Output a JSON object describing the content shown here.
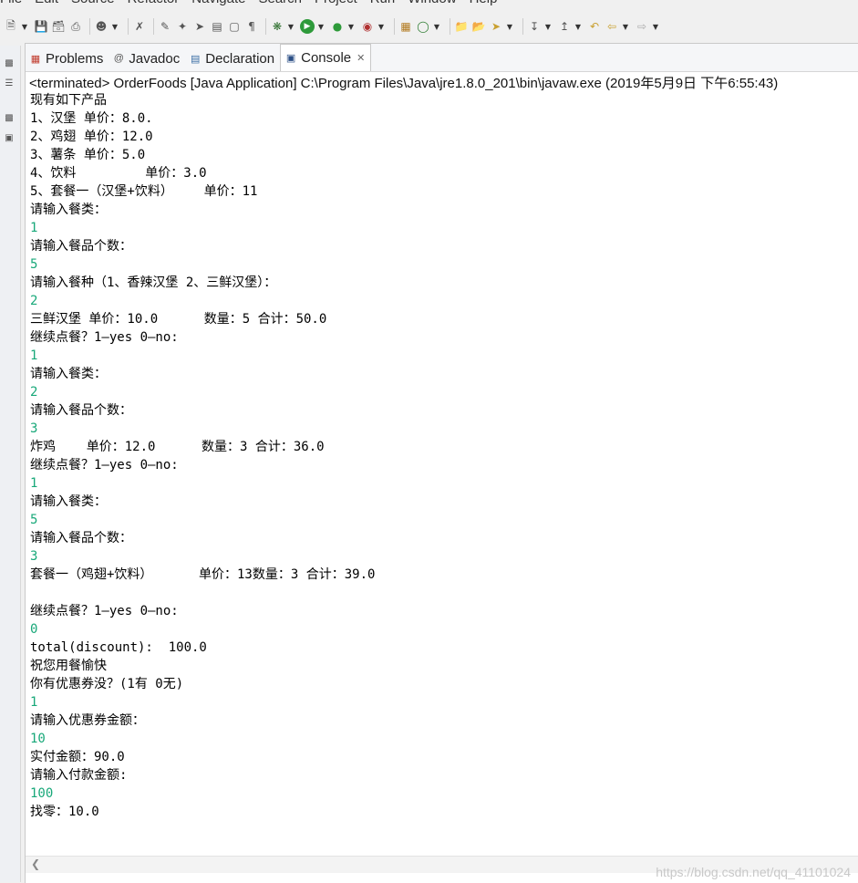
{
  "menubar": {
    "items": [
      "File",
      "Edit",
      "Source",
      "Refactor",
      "Navigate",
      "Search",
      "Project",
      "Run",
      "Window",
      "Help"
    ]
  },
  "tabs": [
    {
      "label": "Problems",
      "icon": "problems-icon"
    },
    {
      "label": "Javadoc",
      "icon": "at-icon"
    },
    {
      "label": "Declaration",
      "icon": "declaration-icon"
    },
    {
      "label": "Console",
      "icon": "console-icon"
    }
  ],
  "console": {
    "title": "<terminated> OrderFoods [Java Application] C:\\Program Files\\Java\\jre1.8.0_201\\bin\\javaw.exe (2019年5月9日 下午6:55:43)",
    "lines": [
      {
        "text": "现有如下产品",
        "type": "out"
      },
      {
        "text": "1、汉堡 单价：8.0.",
        "type": "out"
      },
      {
        "text": "2、鸡翅 单价：12.0",
        "type": "out"
      },
      {
        "text": "3、薯条 单价：5.0",
        "type": "out"
      },
      {
        "text": "4、饮料         单价：3.0",
        "type": "out"
      },
      {
        "text": "5、套餐一（汉堡+饮料）    单价：11",
        "type": "out"
      },
      {
        "text": "请输入餐类：",
        "type": "out"
      },
      {
        "text": "1",
        "type": "in"
      },
      {
        "text": "请输入餐品个数：",
        "type": "out"
      },
      {
        "text": "5",
        "type": "in"
      },
      {
        "text": "请输入餐种（1、香辣汉堡 2、三鲜汉堡）：",
        "type": "out"
      },
      {
        "text": "2",
        "type": "in"
      },
      {
        "text": "三鲜汉堡 单价：10.0      数量：5 合计：50.0",
        "type": "out"
      },
      {
        "text": "继续点餐？1—yes 0—no:",
        "type": "out"
      },
      {
        "text": "1",
        "type": "in"
      },
      {
        "text": "请输入餐类：",
        "type": "out"
      },
      {
        "text": "2",
        "type": "in"
      },
      {
        "text": "请输入餐品个数：",
        "type": "out"
      },
      {
        "text": "3",
        "type": "in"
      },
      {
        "text": "炸鸡    单价：12.0      数量：3 合计：36.0",
        "type": "out"
      },
      {
        "text": "继续点餐？1—yes 0—no:",
        "type": "out"
      },
      {
        "text": "1",
        "type": "in"
      },
      {
        "text": "请输入餐类：",
        "type": "out"
      },
      {
        "text": "5",
        "type": "in"
      },
      {
        "text": "请输入餐品个数：",
        "type": "out"
      },
      {
        "text": "3",
        "type": "in"
      },
      {
        "text": "套餐一（鸡翅+饮料）      单价：13数量：3 合计：39.0",
        "type": "out"
      },
      {
        "text": "",
        "type": "out"
      },
      {
        "text": "继续点餐？1—yes 0—no:",
        "type": "out"
      },
      {
        "text": "0",
        "type": "in"
      },
      {
        "text": "total(discount):  100.0",
        "type": "out"
      },
      {
        "text": "祝您用餐愉快",
        "type": "out"
      },
      {
        "text": "你有优惠券没？(1有 0无)",
        "type": "out"
      },
      {
        "text": "1",
        "type": "in"
      },
      {
        "text": "请输入优惠券金额：",
        "type": "out"
      },
      {
        "text": "10",
        "type": "in"
      },
      {
        "text": "实付金额：90.0",
        "type": "out"
      },
      {
        "text": "请输入付款金额:",
        "type": "out"
      },
      {
        "text": "100",
        "type": "in"
      },
      {
        "text": "找零：10.0",
        "type": "out"
      }
    ]
  },
  "watermark": "https://blog.csdn.net/qq_41101024",
  "colors": {
    "input_text": "#18a879",
    "output_text": "#000000"
  }
}
